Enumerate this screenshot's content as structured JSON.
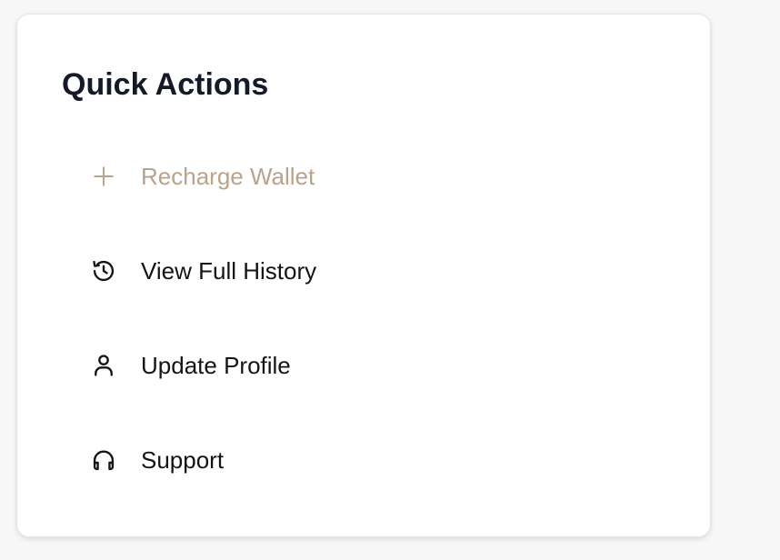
{
  "card": {
    "title": "Quick Actions"
  },
  "actions": [
    {
      "label": "Recharge Wallet",
      "icon": "plus-icon",
      "active": true
    },
    {
      "label": "View Full History",
      "icon": "history-icon",
      "active": false
    },
    {
      "label": "Update Profile",
      "icon": "user-icon",
      "active": false
    },
    {
      "label": "Support",
      "icon": "headphones-icon",
      "active": false
    }
  ],
  "colors": {
    "title": "#141a27",
    "accent": "#bba38a",
    "text": "#141414",
    "card_bg": "#ffffff",
    "page_bg": "#f7f7f7"
  }
}
